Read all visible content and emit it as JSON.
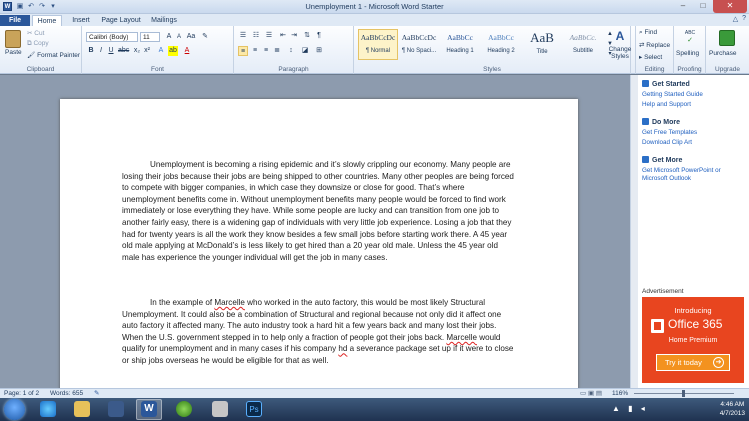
{
  "window": {
    "title": "Unemployment 1 - Microsoft Word Starter"
  },
  "tabs": [
    "File",
    "Home",
    "Insert",
    "Page Layout",
    "Mailings"
  ],
  "clipboard": {
    "paste": "Paste",
    "cut": "Cut",
    "copy": "Copy",
    "format_painter": "Format Painter",
    "label": "Clipboard"
  },
  "font": {
    "name": "Calibri (Body)",
    "size": "11",
    "label": "Font"
  },
  "paragraph": {
    "label": "Paragraph"
  },
  "styles": {
    "label": "Styles",
    "items": [
      {
        "preview": "AaBbCcDc",
        "name": "¶ Normal"
      },
      {
        "preview": "AaBbCcDc",
        "name": "¶ No Spaci..."
      },
      {
        "preview": "AaBbCc",
        "name": "Heading 1"
      },
      {
        "preview": "AaBbCc",
        "name": "Heading 2"
      },
      {
        "preview": "AaB",
        "name": "Title"
      },
      {
        "preview": "AaBbCc.",
        "name": "Subtitle"
      }
    ],
    "change_styles": "Change Styles"
  },
  "editing": {
    "find": "Find",
    "replace": "Replace",
    "select": "Select",
    "label": "Editing"
  },
  "proofing": {
    "spelling": "Spelling",
    "label": "Proofing"
  },
  "upgrade": {
    "purchase": "Purchase",
    "label": "Upgrade"
  },
  "document": {
    "p1": "Unemployment is becoming a rising epidemic and it’s slowly crippling our economy. Many people are losing their jobs because their jobs are being shipped to other countries. Many other peoples are being forced to compete with bigger companies, in which case they downsize or close for good. That’s where unemployment benefits come in. Without unemployment benefits many people would be forced to find work immediately or lose everything they have. While some people are lucky and can transition from one job to another fairly easy, there is a widening gap of individuals with very little job experience.  Losing a job that they had for twenty years is all the work they know besides a few small jobs before starting work there. A 45 year old male applying at McDonald’s is less likely to get hired than a 20 year old male. Unless the 45 year old male has experience  the younger individual will get the job in many cases.",
    "p2_a": "In the example of ",
    "p2_name1": "Marcelle",
    "p2_b": " who worked in the auto factory, this would be most likely Structural Unemployment. It could also be a combination of Structural and regional because not only did it affect one auto factory it affected many. The auto industry took a hard hit a few years back and many lost their jobs. When the U.S. government stepped in to help only a fraction of people got their jobs back. ",
    "p2_name2": "Marcelle",
    "p2_c": " would qualify for unemployment and in many cases if his company ",
    "p2_hd": "hd",
    "p2_d": " a severance package set up if it were to close or ship jobs overseas he would be eligible for that as well."
  },
  "taskpane": {
    "get_started": {
      "title": "Get Started",
      "links": [
        "Getting Started Guide",
        "Help and Support"
      ]
    },
    "do_more": {
      "title": "Do More",
      "links": [
        "Get Free Templates",
        "Download Clip Art"
      ]
    },
    "get_more": {
      "title": "Get More",
      "links": [
        "Get Microsoft PowerPoint or Microsoft Outlook"
      ]
    },
    "ad_label": "Advertisement",
    "ad": {
      "intro": "Introducing",
      "product": "Office 365",
      "edition": "Home Premium",
      "cta": "Try it today"
    }
  },
  "status": {
    "page": "Page: 1 of 2",
    "words": "Words: 655",
    "zoom": "116%"
  },
  "taskbar": {
    "time": "4:46 AM",
    "date": "4/7/2013"
  },
  "colors": {
    "accent": "#2b579a",
    "ad": "#e8451f",
    "ad_button": "#f3921f"
  }
}
